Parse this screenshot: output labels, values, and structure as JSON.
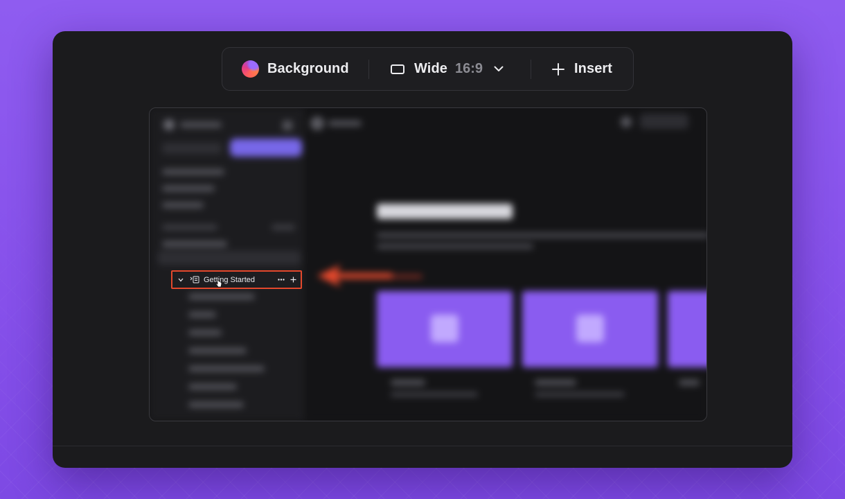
{
  "toolbar": {
    "background_label": "Background",
    "size_label": "Wide",
    "size_ratio": "16:9",
    "insert_label": "Insert"
  },
  "preview": {
    "highlighted_item": "Getting Started"
  },
  "colors": {
    "backdrop": "#8f5cf0",
    "window": "#1b1b1d",
    "highlight_border": "#e4482c",
    "card": "#8a5cf0"
  },
  "icons": [
    "background-swatch-icon",
    "wide-ratio-icon",
    "chevron-down-icon",
    "plus-icon",
    "page-tree-icon",
    "more-icon",
    "cursor-icon",
    "arrow-icon"
  ]
}
